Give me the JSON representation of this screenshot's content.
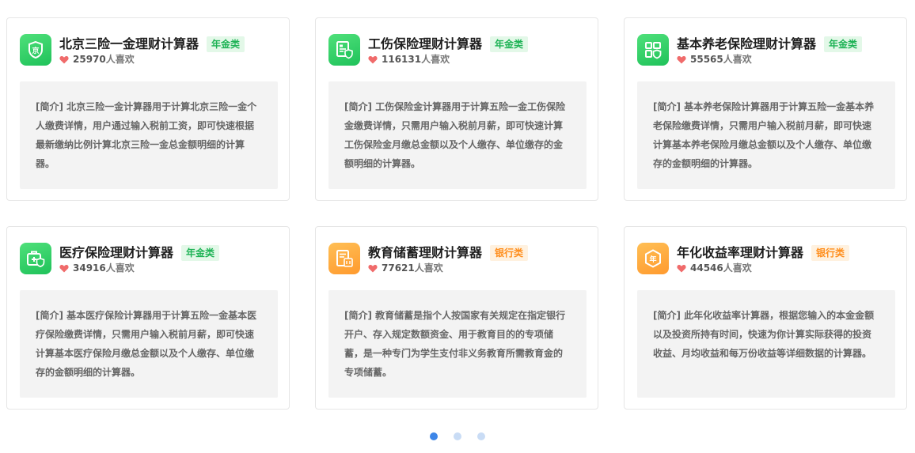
{
  "cards": [
    {
      "title": "北京三险一金理财计算器",
      "badge": "年金类",
      "likes_count": "25970",
      "likes_unit": "人喜欢",
      "desc": "[简介] 北京三险一金计算器用于计算北京三险一金个人缴费详情，用户通过输入税前工资，即可快速根据最新缴纳比例计算北京三险一金总金额明细的计算器。",
      "icon": "beijing-shield-icon",
      "theme": "green"
    },
    {
      "title": "工伤保险理财计算器",
      "badge": "年金类",
      "likes_count": "116131",
      "likes_unit": "人喜欢",
      "desc": "[简介] 工伤保险金计算器用于计算五险一金工伤保险金缴费详情，只需用户输入税前月薪，即可快速计算工伤保险金月缴总金额以及个人缴存、单位缴存的金额明细的计算器。",
      "icon": "document-shield-icon",
      "theme": "green"
    },
    {
      "title": "基本养老保险理财计算器",
      "badge": "年金类",
      "likes_count": "55565",
      "likes_unit": "人喜欢",
      "desc": "[简介] 基本养老保险计算器用于计算五险一金基本养老保险缴费详情，只需用户输入税前月薪，即可快速计算基本养老保险月缴总金额以及个人缴存、单位缴存的金额明细的计算器。",
      "icon": "grid-shield-icon",
      "theme": "green"
    },
    {
      "title": "医疗保险理财计算器",
      "badge": "年金类",
      "likes_count": "34916",
      "likes_unit": "人喜欢",
      "desc": "[简介] 基本医疗保险计算器用于计算五险一金基本医疗保险缴费详情，只需用户输入税前月薪，即可快速计算基本医疗保险月缴总金额以及个人缴存、单位缴存的金额明细的计算器。",
      "icon": "medical-kit-shield-icon",
      "theme": "green"
    },
    {
      "title": "教育储蓄理财计算器",
      "badge": "银行类",
      "likes_count": "77621",
      "likes_unit": "人喜欢",
      "desc": "[简介] 教育储蓄是指个人按国家有关规定在指定银行开户、存入规定数额资金、用于教育目的的专项储蓄，是一种专门为学生支付非义务教育所需教育金的专项储蓄。",
      "icon": "savings-document-icon",
      "theme": "orange"
    },
    {
      "title": "年化收益率理财计算器",
      "badge": "银行类",
      "likes_count": "44546",
      "likes_unit": "人喜欢",
      "desc": "[简介] 此年化收益率计算器，根据您输入的本金金额以及投资所持有时间，快速为你计算实际获得的投资收益、月均收益和每万份收益等详细数据的计算器。",
      "icon": "annual-hexagon-icon",
      "theme": "orange"
    }
  ],
  "pagination": {
    "total": 3,
    "active": 0
  },
  "colors": {
    "green": "#28c960",
    "orange": "#ffa63a",
    "active_dot": "#3d86e8",
    "inactive_dot": "#c9dcf5",
    "heart": "#f06b6b"
  }
}
